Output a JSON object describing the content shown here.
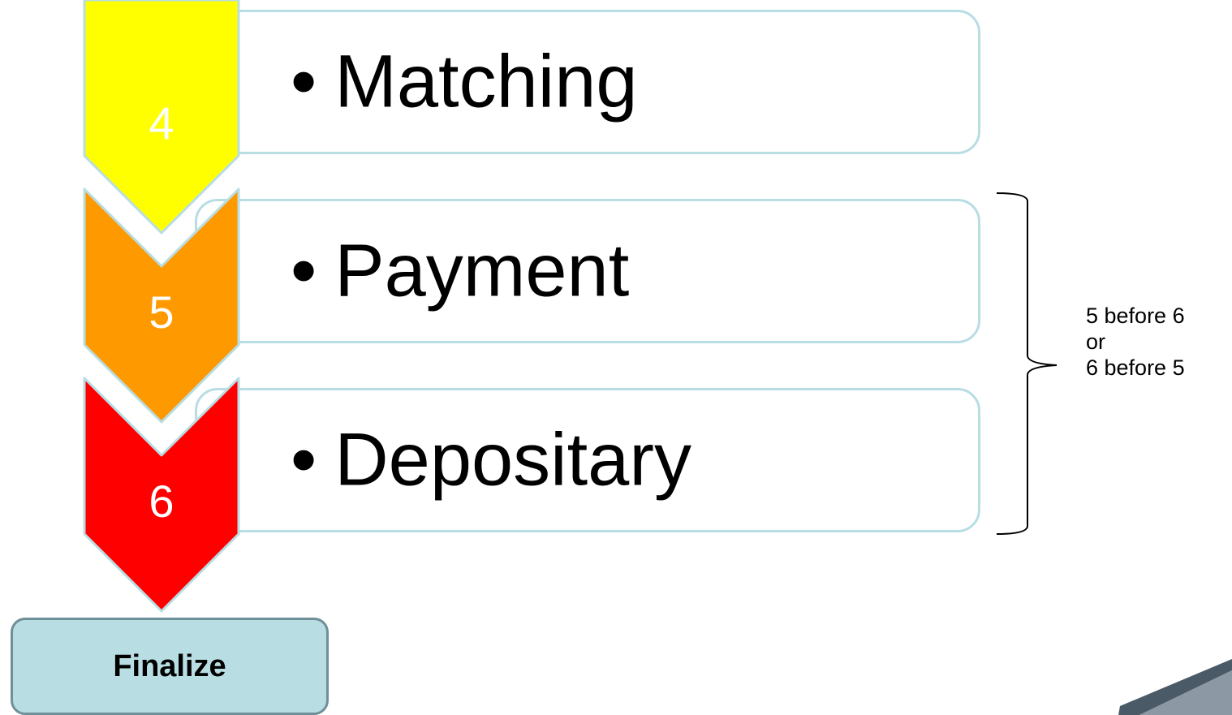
{
  "steps": [
    {
      "number": "4",
      "label": "Matching",
      "color": "#ffff00"
    },
    {
      "number": "5",
      "label": "Payment",
      "color": "#ff9900"
    },
    {
      "number": "6",
      "label": "Depositary",
      "color": "#ff0000"
    }
  ],
  "bullet": "•",
  "note": {
    "line1": "5 before 6",
    "line2": "or",
    "line3": "6 before 5"
  },
  "finalize_label": "Finalize",
  "colors": {
    "box_border": "#b8dde3",
    "chevron_border": "#b8dde3",
    "finalize_fill": "#b8dde3",
    "finalize_border": "#6f8f99"
  }
}
